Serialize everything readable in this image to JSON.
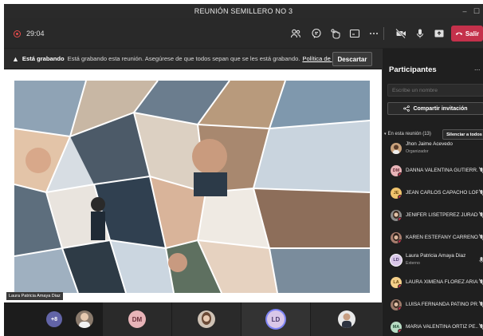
{
  "window": {
    "title": "REUNIÓN SEMILLERO NO 3",
    "minimize_glyph": "–",
    "maximize_glyph": "☐"
  },
  "toolbar": {
    "timer": "29:04",
    "leave_label": "Salir",
    "leave_color": "#c4314b",
    "icons": [
      "participants-icon",
      "chat-icon",
      "reactions-icon",
      "share-tray-icon",
      "more-options-icon",
      "camera-off-icon",
      "microphone-icon",
      "share-screen-icon",
      "phone-hangup-icon"
    ]
  },
  "banner": {
    "strong": "Está grabando",
    "message": "Está grabando esta reunión. Asegúrese de que todos sepan que se les está grabando.",
    "link": "Política de privacidad",
    "dismiss_label": "Descartar"
  },
  "stage": {
    "presenter_label": "Laura Patricia Amaya Diaz"
  },
  "strip": {
    "more_count": "+8",
    "tiles": [
      {
        "initials": "",
        "kind": "photo"
      },
      {
        "initials": "DM",
        "kind": "initials"
      },
      {
        "initials": "",
        "kind": "photo"
      },
      {
        "initials": "LD",
        "kind": "initials",
        "speaking": true
      },
      {
        "initials": "",
        "kind": "photo"
      }
    ]
  },
  "panel": {
    "title": "Participantes",
    "more_glyph": "...",
    "search_placeholder": "Escribe un nombre",
    "share_label": "Compartir invitación",
    "section_label": "En esta reunión (13)",
    "mute_all_label": "Silenciar a todos",
    "participants": [
      {
        "name": "Jhon Jaime Acevedo",
        "role": "Organizador",
        "initials": "",
        "avatar_color": "#c9a27c"
      },
      {
        "name": "DANNA VALENTINA GUTIERR...",
        "role": "",
        "initials": "DM",
        "avatar_color": "#e8b4b8"
      },
      {
        "name": "JEAN CARLOS CAPACHO LÓP...",
        "role": "",
        "initials": "JE",
        "avatar_color": "#f0c36d"
      },
      {
        "name": "JENIFER LISETPEREZ JURADO",
        "role": "",
        "initials": "",
        "avatar_color": "#8a8a8a"
      },
      {
        "name": "KAREN ESTEFANY CARREÑO ...",
        "role": "",
        "initials": "",
        "avatar_color": "#a67c6d"
      },
      {
        "name": "Laura Patricia Amaya Diaz",
        "role": "Externo",
        "initials": "LD",
        "avatar_color": "#d9c7e8"
      },
      {
        "name": "LAURA XIMENA FLOREZ ARIAS",
        "role": "",
        "initials": "LA",
        "avatar_color": "#f5d08a"
      },
      {
        "name": "LUISA FERNANDA PATIÑO PR...",
        "role": "",
        "initials": "",
        "avatar_color": "#9c7a6a"
      },
      {
        "name": "MARIA VALENTINA ORTIZ PE...",
        "role": "",
        "initials": "MA",
        "avatar_color": "#b8dcc4"
      }
    ]
  }
}
